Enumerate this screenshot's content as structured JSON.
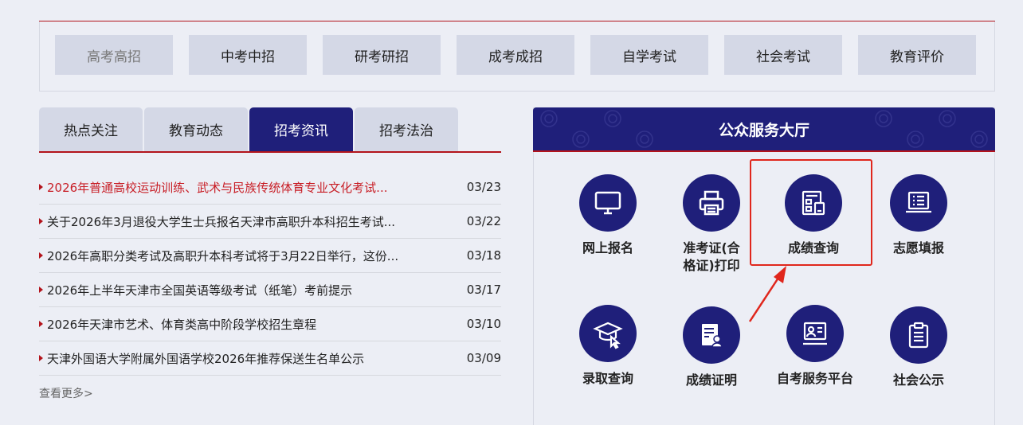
{
  "categories": [
    {
      "label": "高考高招",
      "active": true
    },
    {
      "label": "中考中招"
    },
    {
      "label": "研考研招"
    },
    {
      "label": "成考成招"
    },
    {
      "label": "自学考试"
    },
    {
      "label": "社会考试"
    },
    {
      "label": "教育评价"
    }
  ],
  "tabs": [
    {
      "label": "热点关注"
    },
    {
      "label": "教育动态"
    },
    {
      "label": "招考资讯",
      "active": true
    },
    {
      "label": "招考法治"
    }
  ],
  "news": [
    {
      "title": "2026年普通高校运动训练、武术与民族传统体育专业文化考试...",
      "date": "03/23",
      "hot": true
    },
    {
      "title": "关于2026年3月退役大学生士兵报名天津市高职升本科招生考试...",
      "date": "03/22"
    },
    {
      "title": "2026年高职分类考试及高职升本科考试将于3月22日举行，这份...",
      "date": "03/18"
    },
    {
      "title": "2026年上半年天津市全国英语等级考试（纸笔）考前提示",
      "date": "03/17"
    },
    {
      "title": "2026年天津市艺术、体育类高中阶段学校招生章程",
      "date": "03/10"
    },
    {
      "title": "天津外国语大学附属外国语学校2026年推荐保送生名单公示",
      "date": "03/09"
    }
  ],
  "more_label": "查看更多>",
  "service_hall": {
    "title": "公众服务大厅",
    "items": [
      {
        "label": "网上报名",
        "icon": "monitor-icon"
      },
      {
        "label": "准考证(合格证)打印",
        "label_lines": [
          "准考证(合",
          "格证)打印"
        ],
        "icon": "printer-icon"
      },
      {
        "label": "成绩查询",
        "icon": "score-query-icon"
      },
      {
        "label": "志愿填报",
        "icon": "laptop-list-icon"
      },
      {
        "label": "录取查询",
        "icon": "graduation-cap-icon"
      },
      {
        "label": "成绩证明",
        "icon": "certificate-icon"
      },
      {
        "label": "自考服务平台",
        "icon": "screen-user-icon"
      },
      {
        "label": "社会公示",
        "icon": "clipboard-icon"
      }
    ]
  },
  "colors": {
    "brand": "#1f1f7a",
    "accent_red": "#b3131b",
    "tab_bg": "#d4d8e6",
    "page_bg": "#eceef5"
  }
}
